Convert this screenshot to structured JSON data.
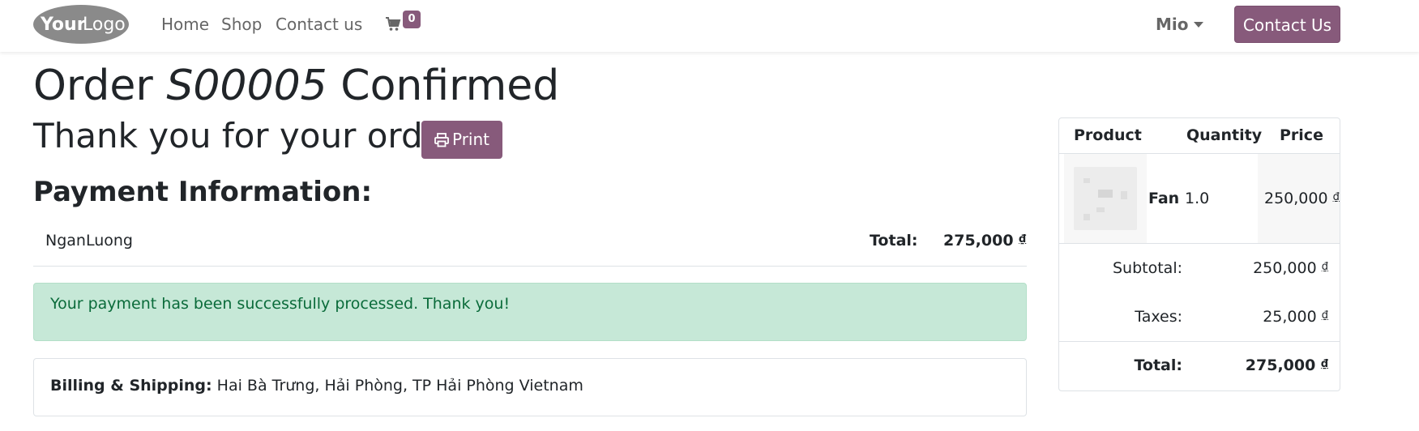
{
  "navbar": {
    "logo_text": "YourLogo",
    "links": [
      "Home",
      "Shop",
      "Contact us"
    ],
    "cart_count": "0",
    "user_name": "Mio",
    "contact_button": "Contact Us"
  },
  "order": {
    "title_prefix": "Order",
    "order_number": "S00005",
    "title_suffix": "Confirmed",
    "thank_you": "Thank you for your order.",
    "print_label": "Print"
  },
  "payment": {
    "heading": "Payment Information:",
    "method": "NganLuong",
    "total_label": "Total:",
    "total_value": "275,000",
    "currency": "₫",
    "success_message": "Your payment has been successfully processed. Thank you!"
  },
  "billing": {
    "label": "Billing & Shipping:",
    "address": "Hai Bà Trưng, Hải Phòng, TP Hải Phòng Vietnam"
  },
  "cart": {
    "headers": [
      "Product",
      "Quantity",
      "Price"
    ],
    "items": [
      {
        "name": "Fan",
        "quantity": "1.0",
        "price": "250,000"
      }
    ],
    "subtotal_label": "Subtotal:",
    "subtotal_value": "250,000",
    "taxes_label": "Taxes:",
    "taxes_value": "25,000",
    "total_label": "Total:",
    "total_value": "275,000",
    "currency": "₫"
  },
  "colors": {
    "brand": "#875A7B",
    "success_bg": "#c6e8d7",
    "success_text": "#0a6b3a"
  }
}
